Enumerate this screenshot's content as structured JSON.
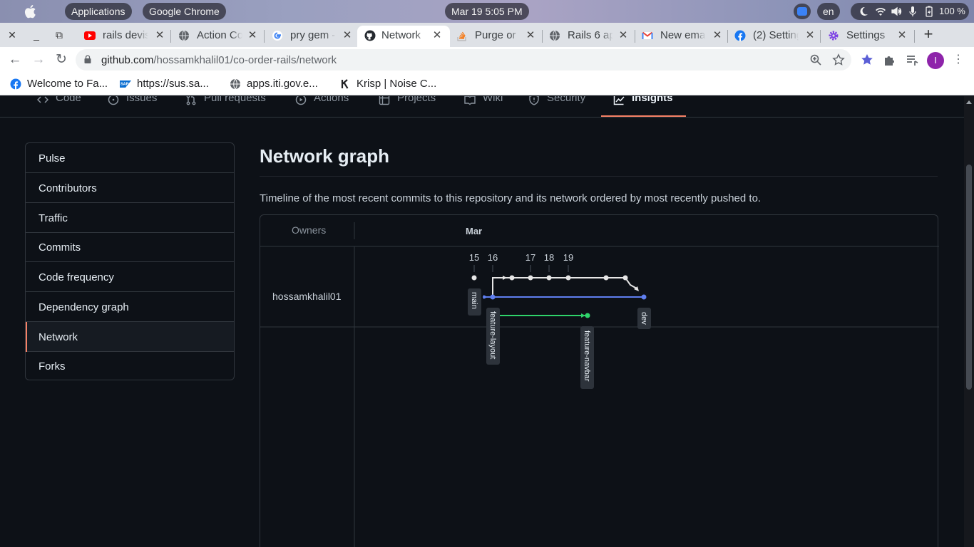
{
  "os": {
    "applications": "Applications",
    "active_app": "Google Chrome",
    "clock": "Mar 19  5:05 PM",
    "lang": "en",
    "battery": "100 %"
  },
  "tabs": [
    {
      "label": "rails devis",
      "icon": "youtube-icon",
      "color": "#ff0000"
    },
    {
      "label": "Action Co",
      "icon": "globe-icon",
      "color": "#5f6368"
    },
    {
      "label": "pry gem -",
      "icon": "google-icon",
      "color": "#4285f4"
    },
    {
      "label": "Network",
      "icon": "github-icon",
      "color": "#24292f",
      "active": true
    },
    {
      "label": "Purge or",
      "icon": "stackoverflow-icon",
      "color": "#f48024"
    },
    {
      "label": "Rails 6 ap",
      "icon": "globe-icon",
      "color": "#5f6368"
    },
    {
      "label": "New emai",
      "icon": "gmail-icon",
      "color": "#ea4335"
    },
    {
      "label": "(2) Setting",
      "icon": "facebook-icon",
      "color": "#1877f2"
    },
    {
      "label": "Settings",
      "icon": "settings-gear-icon",
      "color": "#7b3fe4"
    }
  ],
  "address": {
    "host": "github.com",
    "path": "/hossamkhalil01/co-order-rails/network"
  },
  "profile_initial": "I",
  "bookmarks": [
    {
      "label": "Welcome to Fa...",
      "icon": "facebook-icon"
    },
    {
      "label": "https://sus.sa...",
      "icon": "sap-icon"
    },
    {
      "label": "apps.iti.gov.e...",
      "icon": "globe-icon"
    },
    {
      "label": "Krisp | Noise C...",
      "icon": "krisp-icon"
    }
  ],
  "repo_nav": [
    {
      "label": "Code",
      "icon": "code-icon"
    },
    {
      "label": "Issues",
      "icon": "issue-icon"
    },
    {
      "label": "Pull requests",
      "icon": "pull-request-icon"
    },
    {
      "label": "Actions",
      "icon": "play-icon"
    },
    {
      "label": "Projects",
      "icon": "table-icon"
    },
    {
      "label": "Wiki",
      "icon": "book-icon"
    },
    {
      "label": "Security",
      "icon": "shield-icon"
    },
    {
      "label": "Insights",
      "icon": "graph-icon",
      "selected": true
    }
  ],
  "sidebar": [
    {
      "label": "Pulse"
    },
    {
      "label": "Contributors"
    },
    {
      "label": "Traffic"
    },
    {
      "label": "Commits"
    },
    {
      "label": "Code frequency"
    },
    {
      "label": "Dependency graph"
    },
    {
      "label": "Network",
      "current": true
    },
    {
      "label": "Forks"
    }
  ],
  "main": {
    "title": "Network graph",
    "description": "Timeline of the most recent commits to this repository and its network ordered by most recently pushed to."
  },
  "graph": {
    "owners_header": "Owners",
    "month": "Mar",
    "days": [
      "15",
      "16",
      "17",
      "18",
      "19"
    ],
    "owner": "hossamkhalil01",
    "branch_labels": {
      "main": "main",
      "feature_layout": "feature-layout",
      "feature_navbar": "feature-navbar",
      "dev": "dev"
    },
    "colors": {
      "main": "#e6e6e6",
      "dev": "#5f7ff0",
      "navbar": "#2fd46b"
    }
  }
}
